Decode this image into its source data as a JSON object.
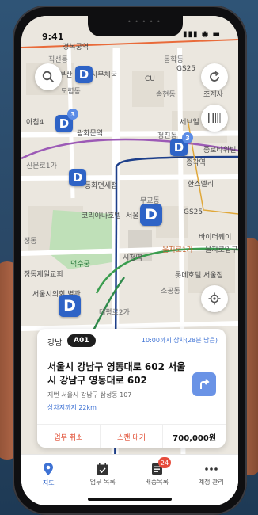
{
  "status": {
    "time": "9:41",
    "icons": "▮▮▮ ◉ ▬"
  },
  "map": {
    "labels": [
      {
        "text": "경복궁역",
        "cls": "dark"
      },
      {
        "text": "직선통",
        "cls": ""
      },
      {
        "text": "동학동",
        "cls": ""
      },
      {
        "text": "부산",
        "cls": "dark"
      },
      {
        "text": "사무체국",
        "cls": "dark"
      },
      {
        "text": "CU",
        "cls": "dark"
      },
      {
        "text": "GS25",
        "cls": "dark"
      },
      {
        "text": "도렴동",
        "cls": ""
      },
      {
        "text": "조계사",
        "cls": "dark"
      },
      {
        "text": "송현동",
        "cls": ""
      },
      {
        "text": "아침4",
        "cls": "dark"
      },
      {
        "text": "광화문역",
        "cls": "dark"
      },
      {
        "text": "세브일",
        "cls": "dark"
      },
      {
        "text": "청진동",
        "cls": ""
      },
      {
        "text": "종로타워빌",
        "cls": "dark"
      },
      {
        "text": "신문로1가",
        "cls": ""
      },
      {
        "text": "종각역",
        "cls": "dark"
      },
      {
        "text": "동화면세점",
        "cls": "dark"
      },
      {
        "text": "한스델리",
        "cls": "dark"
      },
      {
        "text": "무교동",
        "cls": ""
      },
      {
        "text": "코리아나호텔",
        "cls": "dark"
      },
      {
        "text": "서울",
        "cls": "dark"
      },
      {
        "text": "GS25",
        "cls": "dark"
      },
      {
        "text": "정동",
        "cls": ""
      },
      {
        "text": "바이더웨이",
        "cls": "dark"
      },
      {
        "text": "을지로1가",
        "cls": "orange"
      },
      {
        "text": "을지로입구",
        "cls": "dark"
      },
      {
        "text": "덕수궁",
        "cls": "green"
      },
      {
        "text": "시청역",
        "cls": "dark"
      },
      {
        "text": "정동제일교회",
        "cls": "dark"
      },
      {
        "text": "롯데호텔 서울점",
        "cls": "dark"
      },
      {
        "text": "소공동",
        "cls": ""
      },
      {
        "text": "서울시의회 별관",
        "cls": "dark"
      },
      {
        "text": "태평로2가",
        "cls": ""
      }
    ],
    "markers": [
      {
        "letter": "D",
        "badge": ""
      },
      {
        "letter": "D",
        "badge": "3"
      },
      {
        "letter": "D",
        "badge": "3"
      },
      {
        "letter": "D",
        "badge": ""
      },
      {
        "letter": "D",
        "badge": ""
      },
      {
        "letter": "D",
        "badge": ""
      }
    ]
  },
  "controls": {
    "search_icon": "search-icon",
    "refresh_icon": "refresh-icon",
    "barcode_icon": "barcode-icon",
    "locate_icon": "locate-icon"
  },
  "card": {
    "region": "강남",
    "code": "A01",
    "deadline": "10:00까지 상차(28분 남음)",
    "address": "서울시 강남구 영동대로 602 서울시 강남구 영동대로 602",
    "jibun": "지번 서울시 강남구 삼성동 107",
    "distance": "상차지까지 22km",
    "cancel": "업무 취소",
    "scan": "스캔 대기",
    "price": "700,000원"
  },
  "tabs": [
    {
      "label": "지도",
      "icon": "map-pin-icon",
      "active": true,
      "badge": ""
    },
    {
      "label": "업무 목록",
      "icon": "calendar-icon",
      "active": false,
      "badge": ""
    },
    {
      "label": "배송목록",
      "icon": "list-icon",
      "active": false,
      "badge": "24"
    },
    {
      "label": "계정 관리",
      "icon": "more-icon",
      "active": false,
      "badge": ""
    }
  ],
  "colors": {
    "accent": "#2e63c6",
    "danger": "#e04a2f",
    "badge": "#e64b3b"
  }
}
